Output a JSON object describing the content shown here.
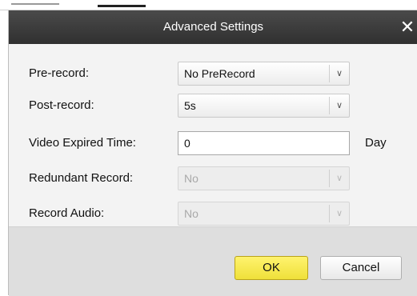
{
  "dialog": {
    "title": "Advanced Settings",
    "close_symbol": "✕"
  },
  "fields": {
    "pre_record": {
      "label": "Pre-record:",
      "value": "No PreRecord",
      "enabled": true
    },
    "post_record": {
      "label": "Post-record:",
      "value": "5s",
      "enabled": true
    },
    "video_expired_time": {
      "label": "Video Expired Time:",
      "value": "0",
      "unit": "Day"
    },
    "redundant_record": {
      "label": "Redundant Record:",
      "value": "No",
      "enabled": false
    },
    "record_audio": {
      "label": "Record Audio:",
      "value": "No",
      "enabled": false
    }
  },
  "buttons": {
    "ok_label": "OK",
    "cancel_label": "Cancel"
  },
  "icons": {
    "dropdown": "chevron-down-icon",
    "close": "close-icon"
  },
  "colors": {
    "titlebar": "#303030",
    "ok_button": "#f3e54a"
  }
}
